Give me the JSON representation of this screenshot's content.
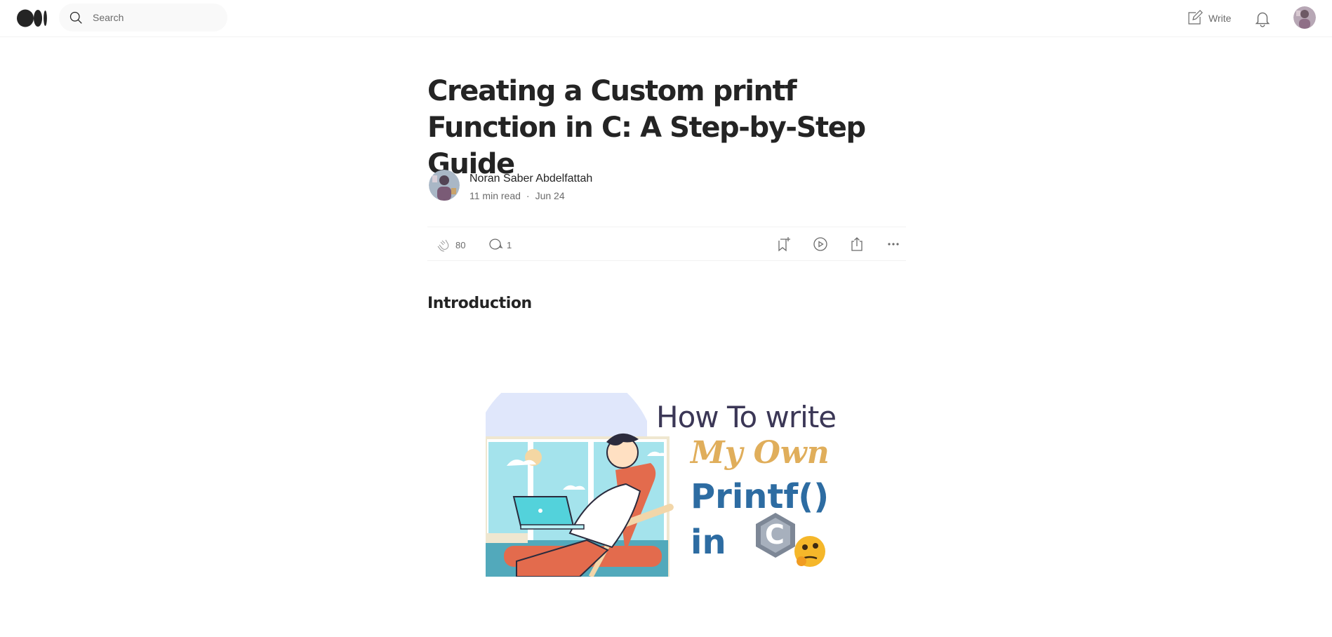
{
  "nav": {
    "logo_alt": "Medium",
    "search_placeholder": "Search",
    "write_label": "Write"
  },
  "article": {
    "title": "Creating a Custom printf Function in C: A Step-by-Step Guide",
    "author": "Noran Saber Abdelfattah",
    "read_time": "11 min read",
    "separator": "·",
    "date": "Jun 24",
    "claps": "80",
    "responses": "1",
    "section_heading": "Introduction"
  },
  "figure": {
    "line1": "How To write",
    "line2": "My Own",
    "line3": "Printf()",
    "line4": "in",
    "c_letter": "C",
    "emoji": "🤔"
  },
  "icons": {
    "search": "search-icon",
    "write": "write-icon",
    "bell": "bell-icon",
    "clap": "clap-icon",
    "response": "response-icon",
    "save": "bookmark-add-icon",
    "listen": "play-icon",
    "share": "share-icon",
    "more": "more-icon"
  },
  "colors": {
    "text": "#242424",
    "muted": "#6b6b6b",
    "figure_blue": "#2d6ca2",
    "figure_gold": "#e0ae5b"
  }
}
